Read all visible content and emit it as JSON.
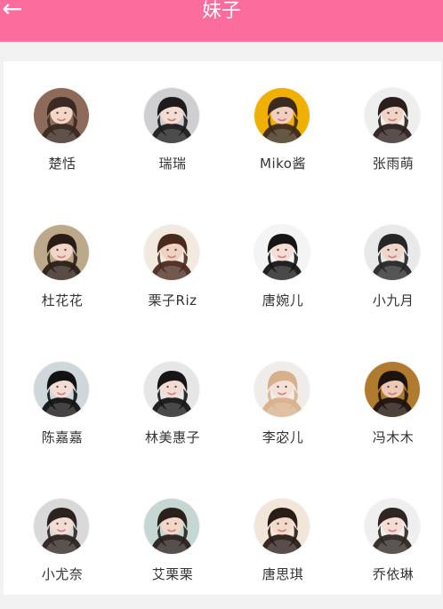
{
  "header": {
    "title": "妹子",
    "back_icon": "arrow-left-icon",
    "background": "#fc6c9c"
  },
  "grid": {
    "items": [
      {
        "name": "楚恬",
        "bg": "#8d6a5a",
        "hair": "#3a2a22",
        "skin": "#f2d7c9"
      },
      {
        "name": "瑞瑞",
        "bg": "#cfcfd1",
        "hair": "#1e1b1c",
        "skin": "#f3dcd2"
      },
      {
        "name": "Miko酱",
        "bg": "#f0b000",
        "hair": "#3b2a1d",
        "skin": "#f2cfc0"
      },
      {
        "name": "张雨萌",
        "bg": "#eeeeee",
        "hair": "#2a1f1c",
        "skin": "#f0d3c5"
      },
      {
        "name": "杜花花",
        "bg": "#bba98a",
        "hair": "#2a1d18",
        "skin": "#f1d6c7"
      },
      {
        "name": "栗子Riz",
        "bg": "#f2e9e1",
        "hair": "#4b2a1e",
        "skin": "#f0d2c3"
      },
      {
        "name": "唐婉儿",
        "bg": "#f4f4f4",
        "hair": "#151515",
        "skin": "#f3ddd5"
      },
      {
        "name": "小九月",
        "bg": "#e9e9e9",
        "hair": "#262626",
        "skin": "#f0d6cb"
      },
      {
        "name": "陈嘉嘉",
        "bg": "#cfd7db",
        "hair": "#121212",
        "skin": "#f2dcd3"
      },
      {
        "name": "林美惠子",
        "bg": "#e6e6e6",
        "hair": "#161616",
        "skin": "#f2dbd1"
      },
      {
        "name": "李宓儿",
        "bg": "#f0ece9",
        "hair": "#d8b18c",
        "skin": "#f5e0d6"
      },
      {
        "name": "冯木木",
        "bg": "#b07a2f",
        "hair": "#1d140f",
        "skin": "#ecc9b6"
      },
      {
        "name": "小尤奈",
        "bg": "#d9d9d9",
        "hair": "#2c2320",
        "skin": "#f3ddd2"
      },
      {
        "name": "艾栗栗",
        "bg": "#c4d7d2",
        "hair": "#2a201c",
        "skin": "#f2d6c8"
      },
      {
        "name": "唐思琪",
        "bg": "#f2e6db",
        "hair": "#2a1d17",
        "skin": "#f3d9cc"
      },
      {
        "name": "乔依琳",
        "bg": "#efefef",
        "hair": "#2f2522",
        "skin": "#f3ddd4"
      }
    ]
  }
}
